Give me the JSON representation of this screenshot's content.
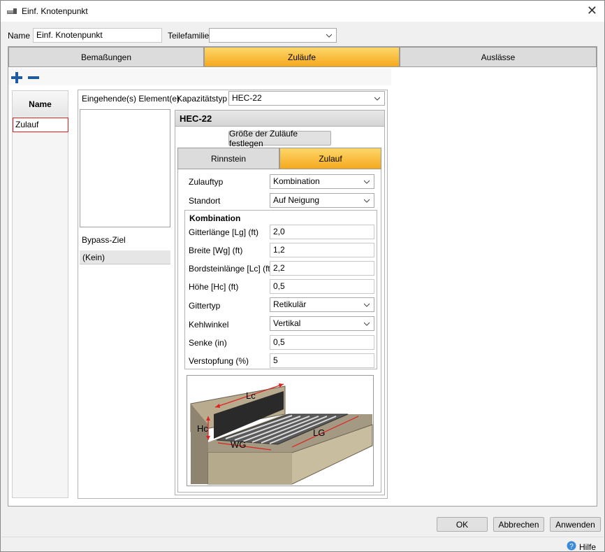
{
  "window": {
    "title": "Einf. Knotenpunkt"
  },
  "header": {
    "name_label": "Name",
    "name_value": "Einf. Knotenpunkt",
    "family_label": "Teilefamilie",
    "family_value": ""
  },
  "tabs": [
    {
      "label": "Bemaßungen"
    },
    {
      "label": "Zuläufe"
    },
    {
      "label": "Auslässe"
    }
  ],
  "left_list": {
    "header": "Name",
    "items": [
      {
        "label": "Zulauf"
      }
    ]
  },
  "middle": {
    "incoming_label": "Eingehende(s) Element(e)",
    "bypass_label": "Bypass-Ziel",
    "bypass_value": "(Kein)"
  },
  "capacity": {
    "label": "Kapazitätstyp",
    "value": "HEC-22",
    "group_title": "HEC-22",
    "size_button": "Größe der Zuläufe festlegen"
  },
  "inner_tabs": [
    {
      "label": "Rinnstein"
    },
    {
      "label": "Zulauf"
    }
  ],
  "inlet": {
    "type_label": "Zulauftyp",
    "type_value": "Kombination",
    "location_label": "Standort",
    "location_value": "Auf Neigung",
    "group_title": "Kombination",
    "fields": [
      {
        "label": "Gitterlänge [Lg] (ft)",
        "value": "2,0"
      },
      {
        "label": "Breite [Wg] (ft)",
        "value": "1,2"
      },
      {
        "label": "Bordsteinlänge [Lc] (ft)",
        "value": "2,2"
      },
      {
        "label": "Höhe [Hc] (ft)",
        "value": "0,5"
      },
      {
        "label": "Gittertyp",
        "value": "Retikulär"
      },
      {
        "label": "Kehlwinkel",
        "value": "Vertikal"
      },
      {
        "label": "Senke (in)",
        "value": "0,5"
      },
      {
        "label": "Verstopfung (%)",
        "value": "5"
      }
    ]
  },
  "diagram": {
    "lc": "Lc",
    "hc": "Hc",
    "wg": "WG",
    "lg": "LG"
  },
  "footer": {
    "ok": "OK",
    "cancel": "Abbrechen",
    "apply": "Anwenden",
    "help": "Hilfe"
  },
  "colors": {
    "active_tab": "#f5a81c",
    "selected_outline": "#e02020",
    "add_icon": "#1f5aa6"
  }
}
